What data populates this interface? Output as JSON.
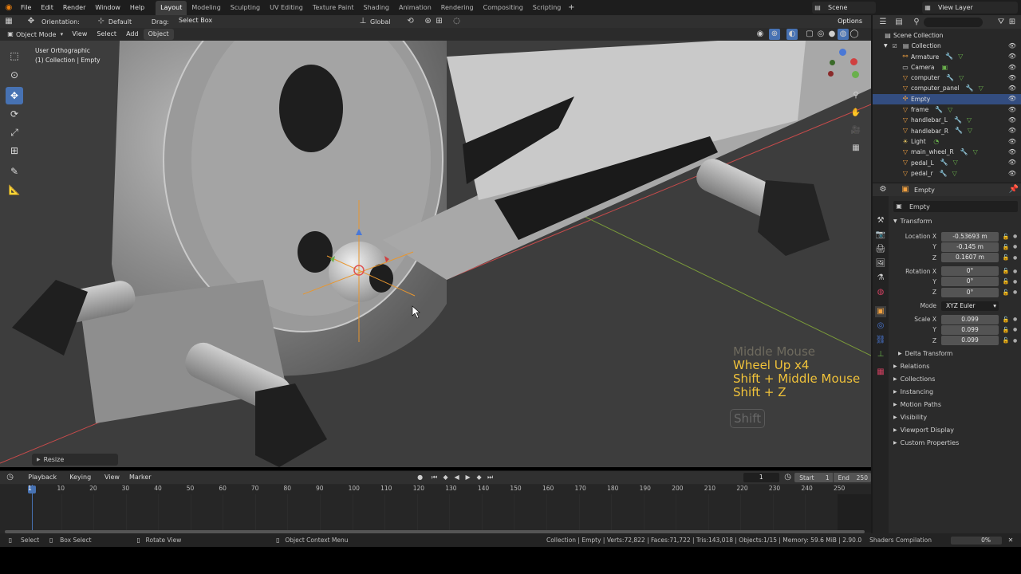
{
  "topbar": {
    "menus": [
      "File",
      "Edit",
      "Render",
      "Window",
      "Help"
    ],
    "workspaces": [
      "Layout",
      "Modeling",
      "Sculpting",
      "UV Editing",
      "Texture Paint",
      "Shading",
      "Animation",
      "Rendering",
      "Compositing",
      "Scripting"
    ],
    "active_workspace": "Layout",
    "scene": "Scene",
    "view_layer": "View Layer"
  },
  "viewport_header": {
    "orientation_label": "Orientation:",
    "orientation_value": "Default",
    "drag_label": "Drag:",
    "drag_value": "Select Box",
    "transform_orientation": "Global",
    "options": "Options",
    "mode": "Object Mode",
    "menus": [
      "View",
      "Select",
      "Add",
      "Object"
    ]
  },
  "viewport": {
    "view_name": "User Orthographic",
    "collection_info": "(1) Collection | Empty",
    "key_overlay": [
      "Middle Mouse",
      "Wheel Up x4",
      "Shift + Middle Mouse",
      "Shift + Z"
    ],
    "modifier_key": "Shift",
    "operator_panel": "Resize"
  },
  "outliner": {
    "root": "Scene Collection",
    "collection": "Collection",
    "items": [
      {
        "name": "Armature",
        "extras": "mod"
      },
      {
        "name": "Camera",
        "extras": "cam"
      },
      {
        "name": "computer",
        "extras": "mod"
      },
      {
        "name": "computer_panel",
        "extras": "mod"
      },
      {
        "name": "Empty",
        "extras": ""
      },
      {
        "name": "frame",
        "extras": "mod"
      },
      {
        "name": "handlebar_L",
        "extras": "mod"
      },
      {
        "name": "handlebar_R",
        "extras": "mod"
      },
      {
        "name": "Light",
        "extras": "light"
      },
      {
        "name": "main_wheel_R",
        "extras": "mod"
      },
      {
        "name": "pedal_L",
        "extras": "mod"
      },
      {
        "name": "pedal_r",
        "extras": "mod"
      }
    ],
    "selected": "Empty"
  },
  "properties": {
    "object_name": "Empty",
    "data_name": "Empty",
    "transform_title": "Transform",
    "location_label": "Location X",
    "location": [
      "-0.53693 m",
      "-0.145 m",
      "0.1607 m"
    ],
    "rotation_label": "Rotation X",
    "rotation": [
      "0°",
      "0°",
      "0°"
    ],
    "mode_label": "Mode",
    "mode_value": "XYZ Euler",
    "scale_label": "Scale X",
    "scale": [
      "0.099",
      "0.099",
      "0.099"
    ],
    "axis_y": "Y",
    "axis_z": "Z",
    "delta_transform": "Delta Transform",
    "sections": [
      "Relations",
      "Collections",
      "Instancing",
      "Motion Paths",
      "Visibility",
      "Viewport Display",
      "Custom Properties"
    ]
  },
  "timeline": {
    "menus": [
      "Playback",
      "Keying",
      "View",
      "Marker"
    ],
    "current_frame": "1",
    "start_label": "Start",
    "start": "1",
    "end_label": "End",
    "end": "250",
    "ticks": [
      "1",
      "10",
      "20",
      "30",
      "40",
      "50",
      "60",
      "70",
      "80",
      "90",
      "100",
      "110",
      "120",
      "130",
      "140",
      "150",
      "160",
      "170",
      "180",
      "190",
      "200",
      "210",
      "220",
      "230",
      "240",
      "250"
    ]
  },
  "statusbar": {
    "select": "Select",
    "box_select": "Box Select",
    "rotate_view": "Rotate View",
    "context_menu": "Object Context Menu",
    "stats": "Collection | Empty | Verts:72,822 | Faces:71,722 | Tris:143,018 | Objects:1/15 | Memory: 59.6 MiB | 2.90.0",
    "job": "Shaders Compilation",
    "progress": "0%"
  },
  "colors": {
    "accent": "#4772b3",
    "selection": "#334d80",
    "x_axis": "#c84b4b",
    "y_axis": "#7a9a3a",
    "empty_orange": "#e8962e"
  }
}
